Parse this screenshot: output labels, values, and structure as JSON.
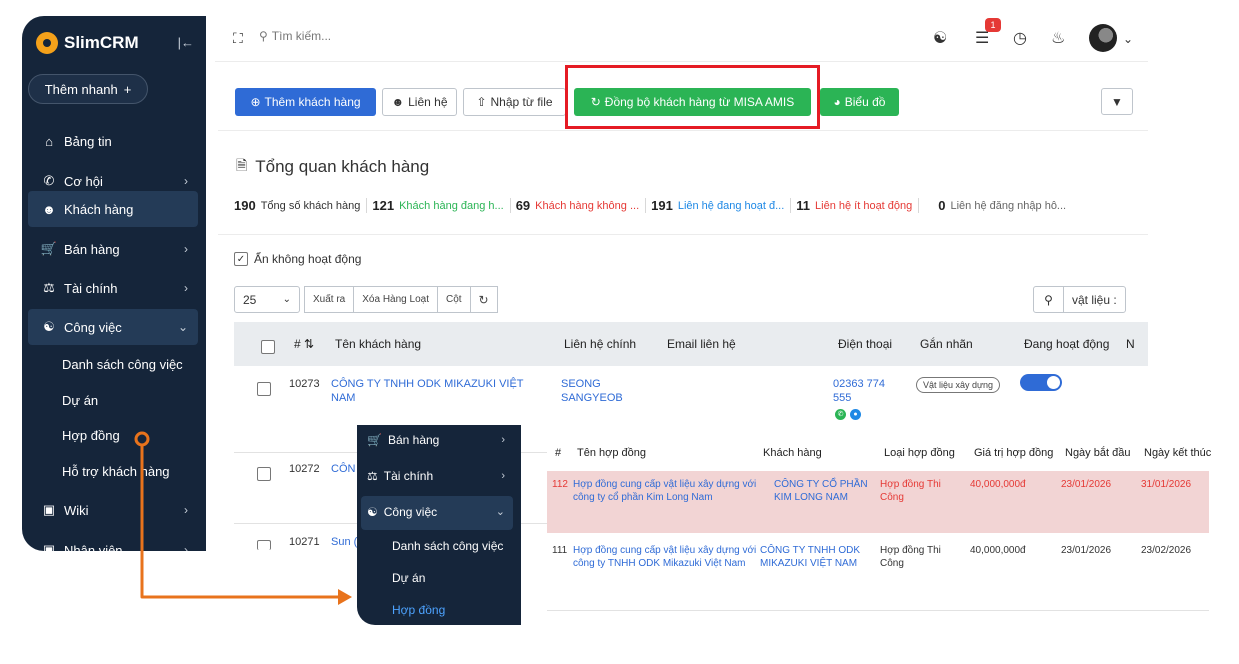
{
  "app": {
    "name": "SlimCRM"
  },
  "sidebar": {
    "quick_add": "Thêm nhanh",
    "items": [
      {
        "label": "Bảng tin",
        "icon": "home-icon"
      },
      {
        "label": "Cơ hội",
        "icon": "phone-icon"
      },
      {
        "label": "Khách hàng",
        "icon": "user-icon"
      },
      {
        "label": "Bán hàng",
        "icon": "cart-icon"
      },
      {
        "label": "Tài chính",
        "icon": "scale-icon"
      },
      {
        "label": "Công việc",
        "icon": "handshake-icon"
      },
      {
        "label": "Wiki",
        "icon": "wiki-icon"
      },
      {
        "label": "Nhân viên",
        "icon": "staff-icon"
      }
    ],
    "subitems": [
      "Danh sách công việc",
      "Dự án",
      "Hợp đồng",
      "Hỗ trợ khách hàng"
    ]
  },
  "topbar": {
    "search_placeholder": "Tìm kiếm...",
    "notification_count": "1"
  },
  "toolbar": {
    "add_customer": "Thêm khách hàng",
    "contact": "Liên hệ",
    "import": "Nhập từ file",
    "sync": "Đồng bộ khách hàng từ MISA AMIS",
    "chart": "Biểu đồ"
  },
  "overview": {
    "title": "Tổng quan khách hàng",
    "stats": [
      {
        "value": "190",
        "label": "Tổng số khách hàng",
        "color": "#333333"
      },
      {
        "value": "121",
        "label": "Khách hàng đang h...",
        "color": "#2bb455"
      },
      {
        "value": "69",
        "label": "Khách hàng không ...",
        "color": "#e53935"
      },
      {
        "value": "191",
        "label": "Liên hệ đang hoạt đ...",
        "color": "#1e88e5"
      },
      {
        "value": "11",
        "label": "Liên hệ ít hoạt động",
        "color": "#e53935"
      },
      {
        "value": "0",
        "label": "Liên hệ đăng nhập hô...",
        "color": "#666666"
      }
    ],
    "hide_inactive": "Ẩn không hoạt động"
  },
  "table_tools": {
    "page_size": "25",
    "export": "Xuất ra",
    "bulk_delete": "Xóa Hàng Loạt",
    "columns": "Cột",
    "search_value": "vật liệu :"
  },
  "customers_table": {
    "headers": [
      "#",
      "Tên khách hàng",
      "Liên hệ chính",
      "Email liên hệ",
      "Điện thoại",
      "Gắn nhãn",
      "Đang hoạt động",
      "N"
    ],
    "rows": [
      {
        "id": "10273",
        "name": "CÔNG TY TNHH ODK MIKAZUKI VIỆT NAM",
        "contact": "SEONG SANGYEOB",
        "phone": "02363 774 555",
        "tag": "Vật liệu xây dựng"
      },
      {
        "id": "10272",
        "name": "CÔN",
        "contact": "",
        "phone": "",
        "tag": ""
      },
      {
        "id": "10271",
        "name": "Sun (",
        "contact": "",
        "phone": "",
        "tag": ""
      }
    ]
  },
  "zoom_sidebar": {
    "items": [
      "Bán hàng",
      "Tài chính",
      "Công việc"
    ],
    "subitems": [
      "Danh sách công việc",
      "Dự án",
      "Hợp đồng"
    ]
  },
  "contracts_table": {
    "headers": [
      "#",
      "Tên hợp đồng",
      "Khách hàng",
      "Loại hợp đồng",
      "Giá trị hợp đồng",
      "Ngày bắt đầu",
      "Ngày kết thúc"
    ],
    "rows": [
      {
        "id": "112",
        "name": "Hợp đồng cung cấp vật liệu xây dựng với công ty cổ phần Kim Long Nam",
        "customer": "CÔNG TY CỔ PHẦN KIM LONG NAM",
        "type": "Hợp đồng Thi Công",
        "value": "40,000,000đ",
        "start": "23/01/2026",
        "end": "31/01/2026"
      },
      {
        "id": "111",
        "name": "Hợp đồng cung cấp vật liệu xây dựng với công ty TNHH ODK Mikazuki Việt Nam",
        "customer": "CÔNG TY TNHH ODK MIKAZUKI VIỆT NAM",
        "type": "Hợp đồng Thi Công",
        "value": "40,000,000đ",
        "start": "23/01/2026",
        "end": "23/02/2026"
      }
    ]
  },
  "colors": {
    "sidebar": "#15253a",
    "primary": "#2f6bd6",
    "success": "#2bb455",
    "danger": "#e53935",
    "highlight": "#e51b24",
    "connector": "#e8731c"
  }
}
